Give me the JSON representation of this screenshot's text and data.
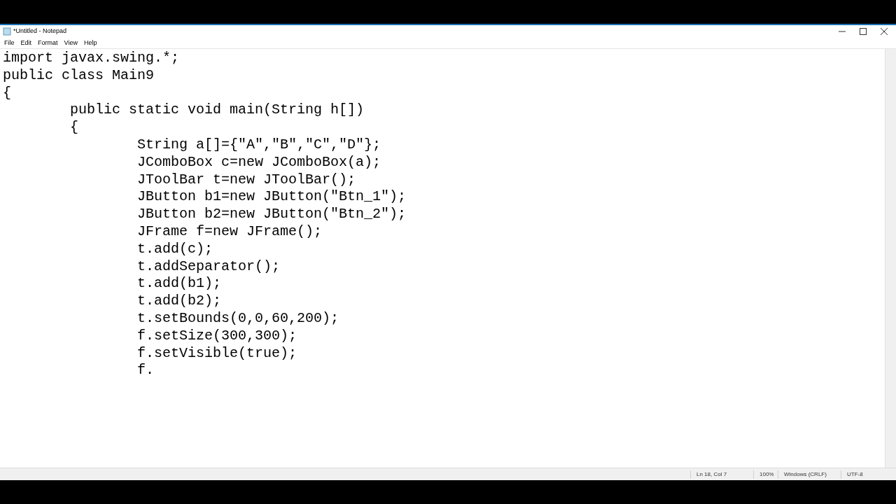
{
  "window": {
    "title": "*Untitled - Notepad"
  },
  "menu": [
    "File",
    "Edit",
    "Format",
    "View",
    "Help"
  ],
  "editor": {
    "lines": [
      "import javax.swing.*;",
      "public class Main9",
      "{",
      "\tpublic static void main(String h[])",
      "\t{",
      "\t\tString a[]={\"A\",\"B\",\"C\",\"D\"};",
      "\t\tJComboBox c=new JComboBox(a);",
      "\t\tJToolBar t=new JToolBar();",
      "\t\tJButton b1=new JButton(\"Btn_1\");",
      "\t\tJButton b2=new JButton(\"Btn_2\");",
      "\t\tJFrame f=new JFrame();",
      "\t\tt.add(c);",
      "\t\tt.addSeparator();",
      "\t\tt.add(b1);",
      "\t\tt.add(b2);",
      "\t\tt.setBounds(0,0,60,200);",
      "\t\tf.setSize(300,300);",
      "\t\tf.setVisible(true);",
      "\t\tf."
    ]
  },
  "status_bar": [
    "Ln 18, Col 7",
    "100%",
    "Windows (CRLF)",
    "UTF-8"
  ]
}
